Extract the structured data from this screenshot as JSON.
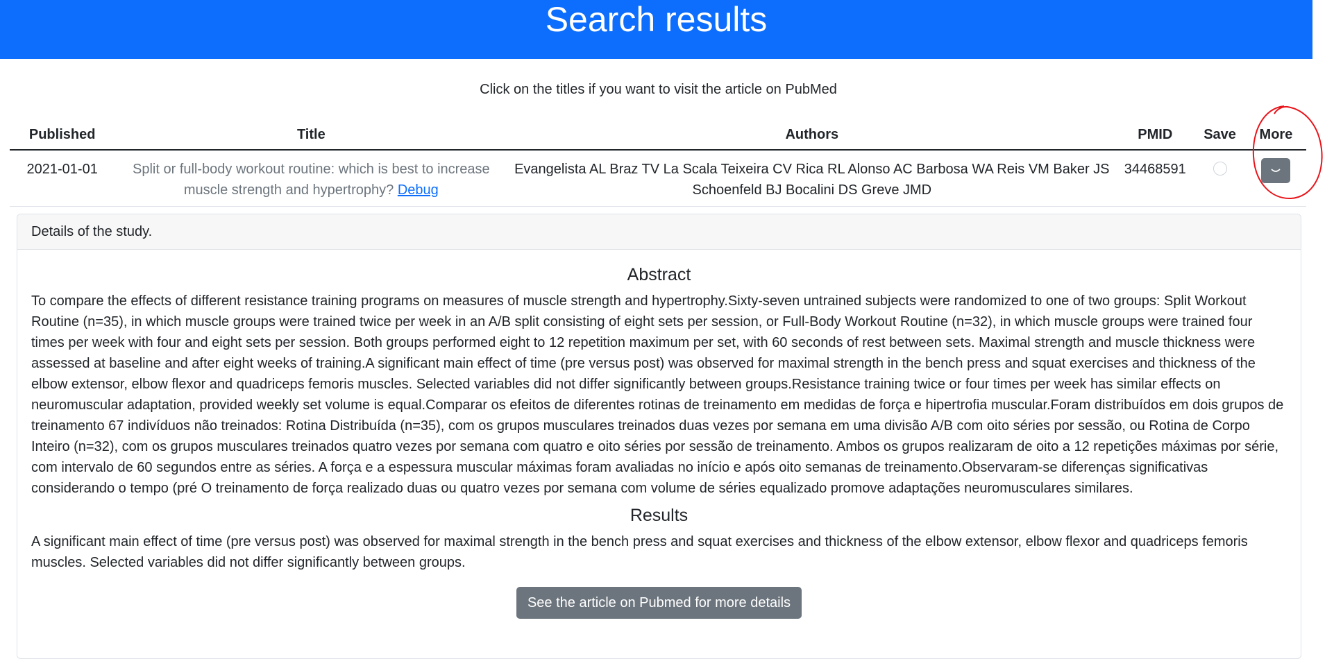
{
  "header": {
    "title": "Search results"
  },
  "instruction": "Click on the titles if you want to visit the article on PubMed",
  "table": {
    "columns": [
      "Published",
      "Title",
      "Authors",
      "PMID",
      "Save",
      "More"
    ],
    "rows": [
      {
        "published": "2021-01-01",
        "title": "Split or full-body workout routine: which is best to increase muscle strength and hypertrophy?",
        "debug_link": "Debug",
        "authors": "Evangelista AL Braz TV La Scala Teixeira CV Rica RL Alonso AC Barbosa WA Reis VM Baker JS Schoenfeld BJ Bocalini DS Greve JMD",
        "pmid": "34468591",
        "save_checked": false,
        "more_icon": "chevron-down-icon"
      }
    ]
  },
  "details": {
    "header": "Details of the study.",
    "abstract_heading": "Abstract",
    "abstract_text": "To compare the effects of different resistance training programs on measures of muscle strength and hypertrophy.Sixty-seven untrained subjects were randomized to one of two groups: Split Workout Routine (n=35), in which muscle groups were trained twice per week in an A/B split consisting of eight sets per session, or Full-Body Workout Routine (n=32), in which muscle groups were trained four times per week with four and eight sets per session. Both groups performed eight to 12 repetition maximum per set, with 60 seconds of rest between sets. Maximal strength and muscle thickness were assessed at baseline and after eight weeks of training.A significant main effect of time (pre versus post) was observed for maximal strength in the bench press and squat exercises and thickness of the elbow extensor, elbow flexor and quadriceps femoris muscles. Selected variables did not differ significantly between groups.Resistance training twice or four times per week has similar effects on neuromuscular adaptation, provided weekly set volume is equal.Comparar os efeitos de diferentes rotinas de treinamento em medidas de força e hipertrofia muscular.Foram distribuídos em dois grupos de treinamento 67 indivíduos não treinados: Rotina Distribuída (n=35), com os grupos musculares treinados duas vezes por semana em uma divisão A/B com oito séries por sessão, ou Rotina de Corpo Inteiro (n=32), com os grupos musculares treinados quatro vezes por semana com quatro e oito séries por sessão de treinamento. Ambos os grupos realizaram de oito a 12 repetições máximas por série, com intervalo de 60 segundos entre as séries. A força e a espessura muscular máximas foram avaliadas no início e após oito semanas de treinamento.Observaram-se diferenças significativas considerando o tempo (pré O treinamento de força realizado duas ou quatro vezes por semana com volume de séries equalizado promove adaptações neuromusculares similares.",
    "results_heading": "Results",
    "results_text": "A significant main effect of time (pre versus post) was observed for maximal strength in the bench press and squat exercises and thickness of the elbow extensor, elbow flexor and quadriceps femoris muscles. Selected variables did not differ significantly between groups.",
    "pubmed_button": "See the article on Pubmed for more details"
  },
  "colors": {
    "primary": "#0d6efd",
    "secondary": "#6c757d",
    "annotation": "#e8141a"
  }
}
